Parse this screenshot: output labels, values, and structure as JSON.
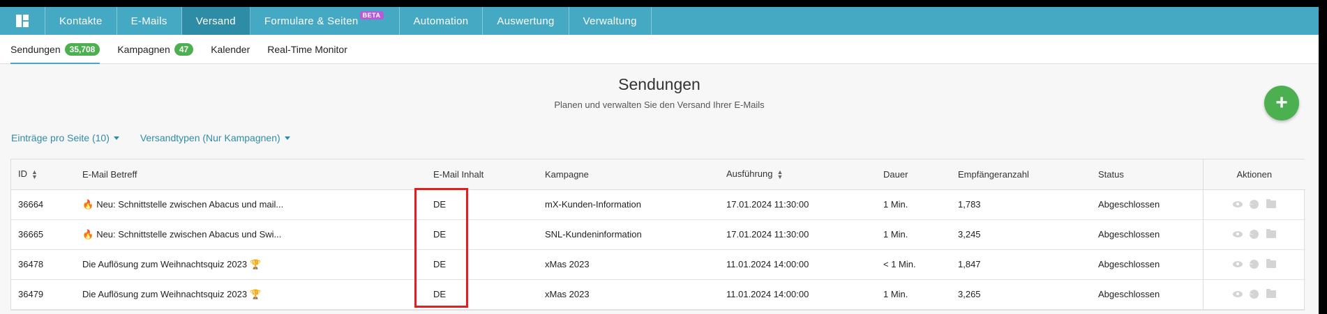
{
  "nav": {
    "items": [
      {
        "label": "Kontakte"
      },
      {
        "label": "E-Mails"
      },
      {
        "label": "Versand",
        "active": true
      },
      {
        "label": "Formulare & Seiten",
        "badge": "BETA"
      },
      {
        "label": "Automation"
      },
      {
        "label": "Auswertung"
      },
      {
        "label": "Verwaltung"
      }
    ]
  },
  "subnav": {
    "items": [
      {
        "label": "Sendungen",
        "count": "35,708",
        "active": true
      },
      {
        "label": "Kampagnen",
        "count": "47"
      },
      {
        "label": "Kalender"
      },
      {
        "label": "Real-Time Monitor"
      }
    ]
  },
  "header": {
    "title": "Sendungen",
    "subtitle": "Planen und verwalten Sie den Versand Ihrer E-Mails",
    "add_label": "+"
  },
  "filters": {
    "per_page": "Einträge pro Seite (10)",
    "types": "Versandtypen (Nur Kampagnen)"
  },
  "table": {
    "columns": {
      "id": "ID",
      "subject": "E-Mail Betreff",
      "content": "E-Mail Inhalt",
      "campaign": "Kampagne",
      "execution": "Ausführung",
      "duration": "Dauer",
      "recipients": "Empfängeranzahl",
      "status": "Status",
      "actions": "Aktionen"
    },
    "rows": [
      {
        "id": "36664",
        "emoji": "🔥",
        "subject": "Neu: Schnittstelle zwischen Abacus und mail...",
        "content": "DE",
        "campaign": "mX-Kunden-Information",
        "execution": "17.01.2024 11:30:00",
        "duration": "1 Min.",
        "recipients": "1,783",
        "status": "Abgeschlossen"
      },
      {
        "id": "36665",
        "emoji": "🔥",
        "subject": "Neu: Schnittstelle zwischen Abacus und Swi...",
        "content": "DE",
        "campaign": "SNL-Kundeninformation",
        "execution": "17.01.2024 11:30:00",
        "duration": "1 Min.",
        "recipients": "3,245",
        "status": "Abgeschlossen"
      },
      {
        "id": "36478",
        "subject": "Die Auflösung zum Weihnachtsquiz 2023",
        "trophy": "🏆",
        "content": "DE",
        "campaign": "xMas 2023",
        "execution": "11.01.2024 14:00:00",
        "duration": "< 1 Min.",
        "recipients": "1,847",
        "status": "Abgeschlossen"
      },
      {
        "id": "36479",
        "subject": "Die Auflösung zum Weihnachtsquiz 2023",
        "trophy": "🏆",
        "content": "DE",
        "campaign": "xMas 2023",
        "execution": "11.01.2024 14:00:00",
        "duration": "1 Min.",
        "recipients": "3,265",
        "status": "Abgeschlossen"
      }
    ]
  },
  "colors": {
    "nav_bg": "#45a9c4",
    "nav_active": "#2f8ca6",
    "badge_green": "#4caf50",
    "beta_purple": "#b65cd8",
    "highlight_red": "#e02020"
  }
}
